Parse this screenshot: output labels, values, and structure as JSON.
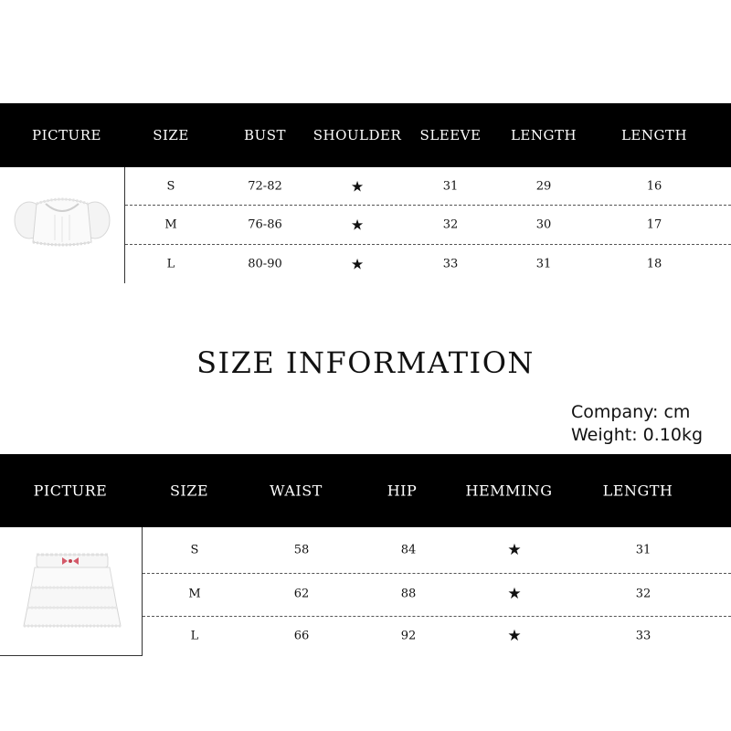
{
  "top_table": {
    "headers": [
      "PICTURE",
      "SIZE",
      "BUST",
      "SHOULDER",
      "SLEEVE",
      "LENGTH",
      "LENGTH"
    ],
    "picture": "white puffed-sleeve crop top",
    "rows": [
      [
        "S",
        "72-82",
        "★",
        "31",
        "29",
        "16"
      ],
      [
        "M",
        "76-86",
        "★",
        "32",
        "30",
        "17"
      ],
      [
        "L",
        "80-90",
        "★",
        "33",
        "31",
        "18"
      ]
    ]
  },
  "title": "SIZE INFORMATION",
  "info": {
    "company": "Company: cm",
    "weight": "Weight: 0.10kg"
  },
  "bottom_table": {
    "headers": [
      "PICTURE",
      "SIZE",
      "WAIST",
      "HIP",
      "HEMMING",
      "LENGTH"
    ],
    "picture": "white tiered lace ruffle skirt",
    "rows": [
      [
        "S",
        "58",
        "84",
        "★",
        "31"
      ],
      [
        "M",
        "62",
        "88",
        "★",
        "32"
      ],
      [
        "L",
        "66",
        "92",
        "★",
        "33"
      ]
    ]
  }
}
